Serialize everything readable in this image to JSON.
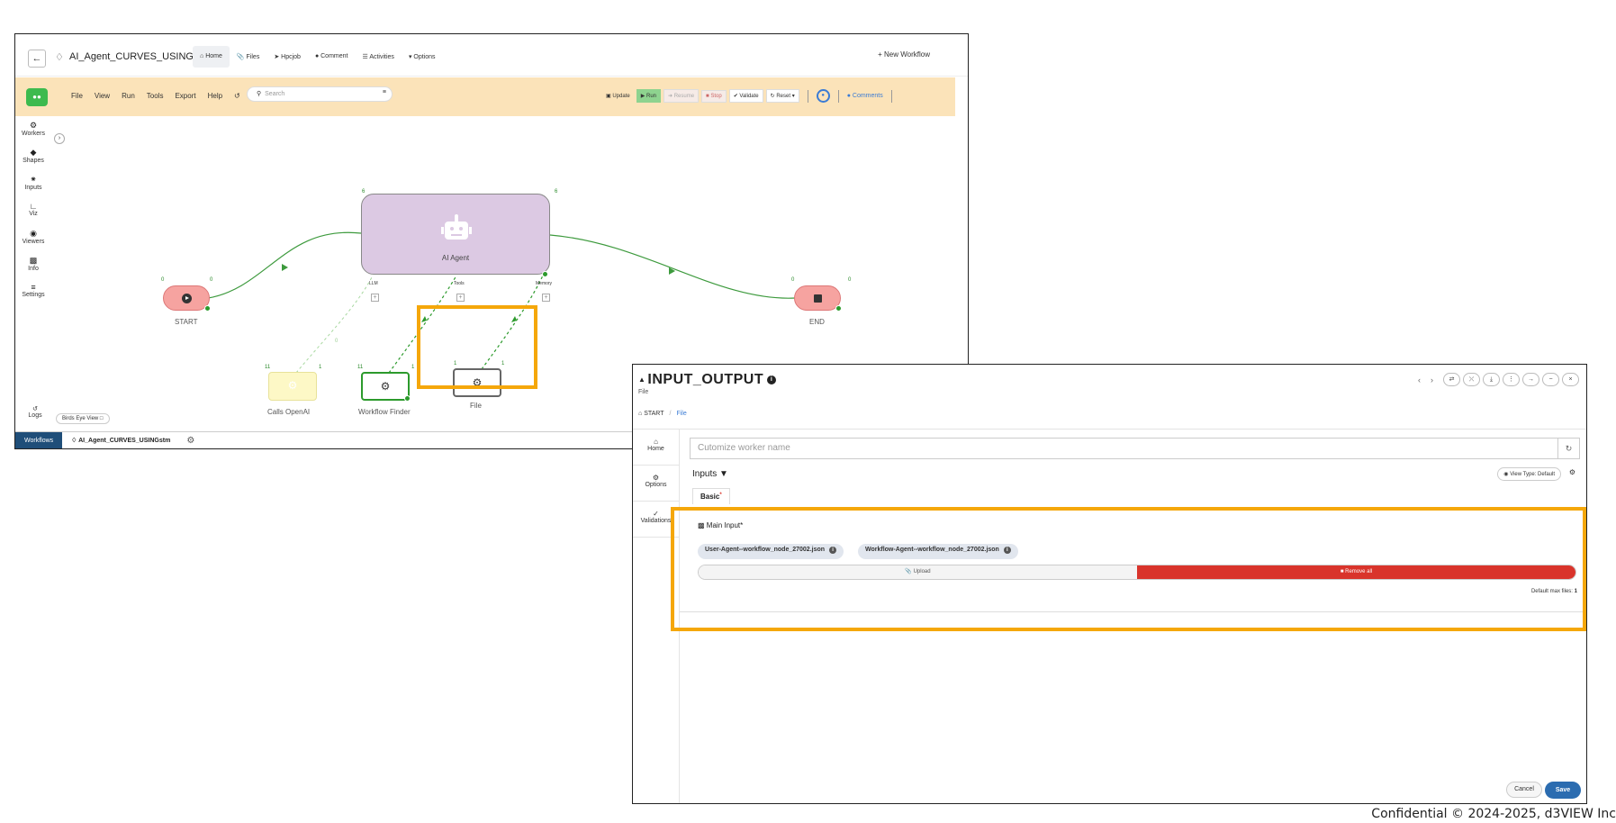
{
  "workflow_window": {
    "title": "AI_Agent_CURVES_USINGstm",
    "tabs": [
      {
        "icon": "home-icon",
        "label": "Home"
      },
      {
        "icon": "paperclip-icon",
        "label": "Files"
      },
      {
        "icon": "pin-icon",
        "label": "Hpcjob"
      },
      {
        "icon": "comments-icon",
        "label": "Comment"
      },
      {
        "icon": "list-icon",
        "label": "Activities"
      },
      {
        "icon": "caret-icon",
        "label": "Options"
      }
    ],
    "new_workflow": "+ New Workflow",
    "menu": [
      "File",
      "View",
      "Run",
      "Tools",
      "Export",
      "Help"
    ],
    "search_placeholder": "Search",
    "toolbar": {
      "update": "Update",
      "run": "Run",
      "resume": "Resume",
      "stop": "Stop",
      "validate": "Validate",
      "reset": "Reset",
      "comments": "Comments"
    },
    "sidebar": [
      {
        "icon": "gear-icon",
        "label": "Workers"
      },
      {
        "icon": "diamond-icon",
        "label": "Shapes"
      },
      {
        "icon": "inputs-icon",
        "label": "Inputs"
      },
      {
        "icon": "chart-icon",
        "label": "Viz"
      },
      {
        "icon": "eye-icon",
        "label": "Viewers"
      },
      {
        "icon": "file-icon",
        "label": "Info"
      },
      {
        "icon": "sliders-icon",
        "label": "Settings"
      }
    ],
    "logs": "Logs",
    "birds_eye": "Birds Eye View",
    "nodes": {
      "start": {
        "label": "START",
        "in": "0",
        "out": "0"
      },
      "end": {
        "label": "END",
        "in": "0",
        "out": "0"
      },
      "agent": {
        "label": "AI Agent",
        "in": "6",
        "out": "6",
        "ports": [
          "LLM",
          "Tools",
          "Memory"
        ]
      },
      "openai": {
        "label": "Calls OpenAI",
        "in": "11",
        "out": "1"
      },
      "finder": {
        "label": "Workflow Finder",
        "in": "11",
        "out": "1"
      },
      "file": {
        "label": "File",
        "in": "1",
        "out": "1"
      },
      "edge_label": "0"
    },
    "bottom_tabs": [
      "Workflows",
      "AI_Agent_CURVES_USINGstm"
    ]
  },
  "dialog": {
    "title": "INPUT_OUTPUT",
    "subtitle": "File",
    "breadcrumb": {
      "root": "START",
      "current": "File"
    },
    "side_tabs": [
      {
        "icon": "home-icon",
        "label": "Home"
      },
      {
        "icon": "gear-icon",
        "label": "Options"
      },
      {
        "icon": "check-icon",
        "label": "Validations"
      }
    ],
    "name_placeholder": "Cutomize worker name",
    "inputs_label": "Inputs",
    "view_type": "View Type: Default",
    "basic_tab": "Basic",
    "main_input": "Main Input",
    "files": [
      "User-Agent--workflow_node_27002.json",
      "Workflow-Agent--workflow_node_27002.json"
    ],
    "upload": "Upload",
    "remove_all": "Remove all",
    "max_files_label": "Default max files:",
    "max_files_value": "1",
    "cancel": "Cancel",
    "save": "Save"
  },
  "footer": "Confidential © 2024-2025, d3VIEW Inc"
}
